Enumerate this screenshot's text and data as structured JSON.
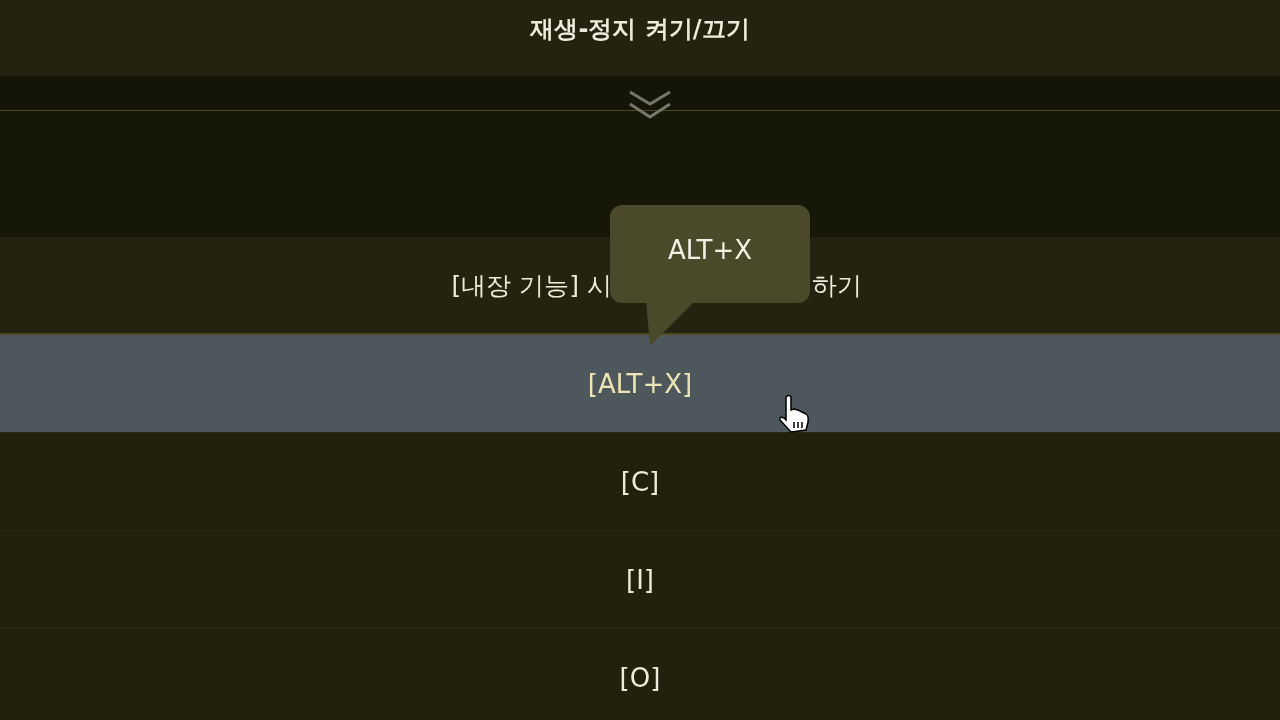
{
  "header": {
    "title": "재생-정지 켜기/끄기"
  },
  "section": {
    "title_parts": [
      "[내장 기능] 시",
      "하기"
    ]
  },
  "tooltip": {
    "text": "ALT+X"
  },
  "rows": [
    {
      "label": "[ALT+X]",
      "selected": true
    },
    {
      "label": "[C]",
      "selected": false
    },
    {
      "label": "[I]",
      "selected": false
    },
    {
      "label": "[O]",
      "selected": false
    }
  ]
}
